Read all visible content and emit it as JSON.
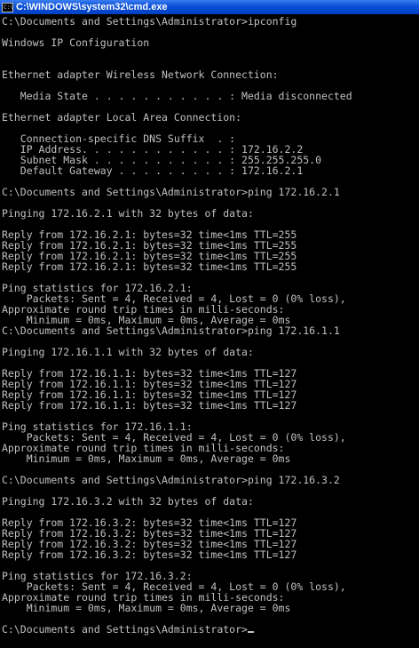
{
  "window": {
    "title": "C:\\WINDOWS\\system32\\cmd.exe",
    "icon": "cmd-icon",
    "icon_text": "C:\\"
  },
  "colors": {
    "background": "#000000",
    "text": "#c0c0c0",
    "titlebar": "#0a4fd6"
  },
  "console": {
    "lines": [
      "C:\\Documents and Settings\\Administrator>ipconfig",
      "",
      "Windows IP Configuration",
      "",
      "",
      "Ethernet adapter Wireless Network Connection:",
      "",
      "   Media State . . . . . . . . . . . : Media disconnected",
      "",
      "Ethernet adapter Local Area Connection:",
      "",
      "   Connection-specific DNS Suffix  . :",
      "   IP Address. . . . . . . . . . . . : 172.16.2.2",
      "   Subnet Mask . . . . . . . . . . . : 255.255.255.0",
      "   Default Gateway . . . . . . . . . : 172.16.2.1",
      "",
      "C:\\Documents and Settings\\Administrator>ping 172.16.2.1",
      "",
      "Pinging 172.16.2.1 with 32 bytes of data:",
      "",
      "Reply from 172.16.2.1: bytes=32 time<1ms TTL=255",
      "Reply from 172.16.2.1: bytes=32 time<1ms TTL=255",
      "Reply from 172.16.2.1: bytes=32 time<1ms TTL=255",
      "Reply from 172.16.2.1: bytes=32 time<1ms TTL=255",
      "",
      "Ping statistics for 172.16.2.1:",
      "    Packets: Sent = 4, Received = 4, Lost = 0 (0% loss),",
      "Approximate round trip times in milli-seconds:",
      "    Minimum = 0ms, Maximum = 0ms, Average = 0ms",
      "C:\\Documents and Settings\\Administrator>ping 172.16.1.1",
      "",
      "Pinging 172.16.1.1 with 32 bytes of data:",
      "",
      "Reply from 172.16.1.1: bytes=32 time<1ms TTL=127",
      "Reply from 172.16.1.1: bytes=32 time<1ms TTL=127",
      "Reply from 172.16.1.1: bytes=32 time<1ms TTL=127",
      "Reply from 172.16.1.1: bytes=32 time<1ms TTL=127",
      "",
      "Ping statistics for 172.16.1.1:",
      "    Packets: Sent = 4, Received = 4, Lost = 0 (0% loss),",
      "Approximate round trip times in milli-seconds:",
      "    Minimum = 0ms, Maximum = 0ms, Average = 0ms",
      "",
      "C:\\Documents and Settings\\Administrator>ping 172.16.3.2",
      "",
      "Pinging 172.16.3.2 with 32 bytes of data:",
      "",
      "Reply from 172.16.3.2: bytes=32 time<1ms TTL=127",
      "Reply from 172.16.3.2: bytes=32 time<1ms TTL=127",
      "Reply from 172.16.3.2: bytes=32 time<1ms TTL=127",
      "Reply from 172.16.3.2: bytes=32 time<1ms TTL=127",
      "",
      "Ping statistics for 172.16.3.2:",
      "    Packets: Sent = 4, Received = 4, Lost = 0 (0% loss),",
      "Approximate round trip times in milli-seconds:",
      "    Minimum = 0ms, Maximum = 0ms, Average = 0ms",
      "",
      "C:\\Documents and Settings\\Administrator>"
    ]
  }
}
